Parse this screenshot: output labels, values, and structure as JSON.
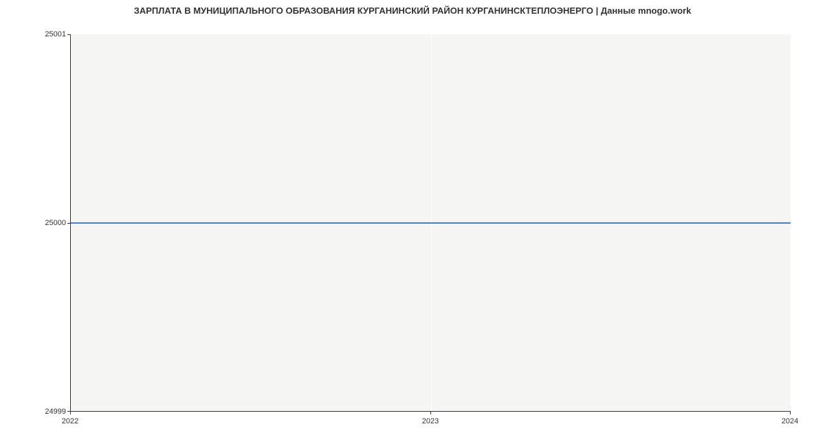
{
  "chart_data": {
    "type": "line",
    "title": "ЗАРПЛАТА В МУНИЦИПАЛЬНОГО ОБРАЗОВАНИЯ КУРГАНИНСКИЙ РАЙОН КУРГАНИНСКТЕПЛОЭНЕРГО | Данные mnogo.work",
    "x": [
      2022,
      2023,
      2024
    ],
    "values": [
      25000,
      25000,
      25000
    ],
    "xlabel": "",
    "ylabel": "",
    "xlim": [
      2022,
      2024
    ],
    "ylim": [
      24999,
      25001
    ],
    "x_ticks": [
      "2022",
      "2023",
      "2024"
    ],
    "y_ticks": [
      "24999",
      "25000",
      "25001"
    ]
  }
}
